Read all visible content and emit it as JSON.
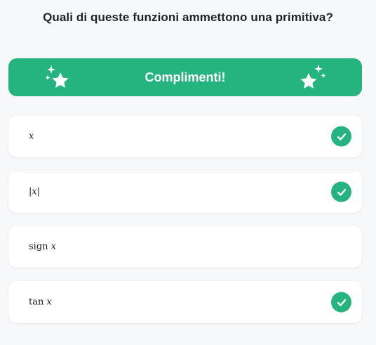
{
  "question": "Quali di queste funzioni ammettono una primitiva?",
  "banner": {
    "text": "Complimenti!",
    "icons": [
      "sparkle-stars-icon",
      "sparkle-stars-icon"
    ]
  },
  "options": [
    {
      "fn": "",
      "var": "x",
      "wrap_left": "",
      "wrap_right": "",
      "checked": true
    },
    {
      "fn": "",
      "var": "x",
      "wrap_left": "|",
      "wrap_right": "|",
      "checked": true
    },
    {
      "fn": "sign ",
      "var": "x",
      "wrap_left": "",
      "wrap_right": "",
      "checked": false
    },
    {
      "fn": "tan ",
      "var": "x",
      "wrap_left": "",
      "wrap_right": "",
      "checked": true
    }
  ],
  "colors": {
    "accent": "#25b37f",
    "background": "#f7f8fa",
    "card": "#ffffff"
  }
}
